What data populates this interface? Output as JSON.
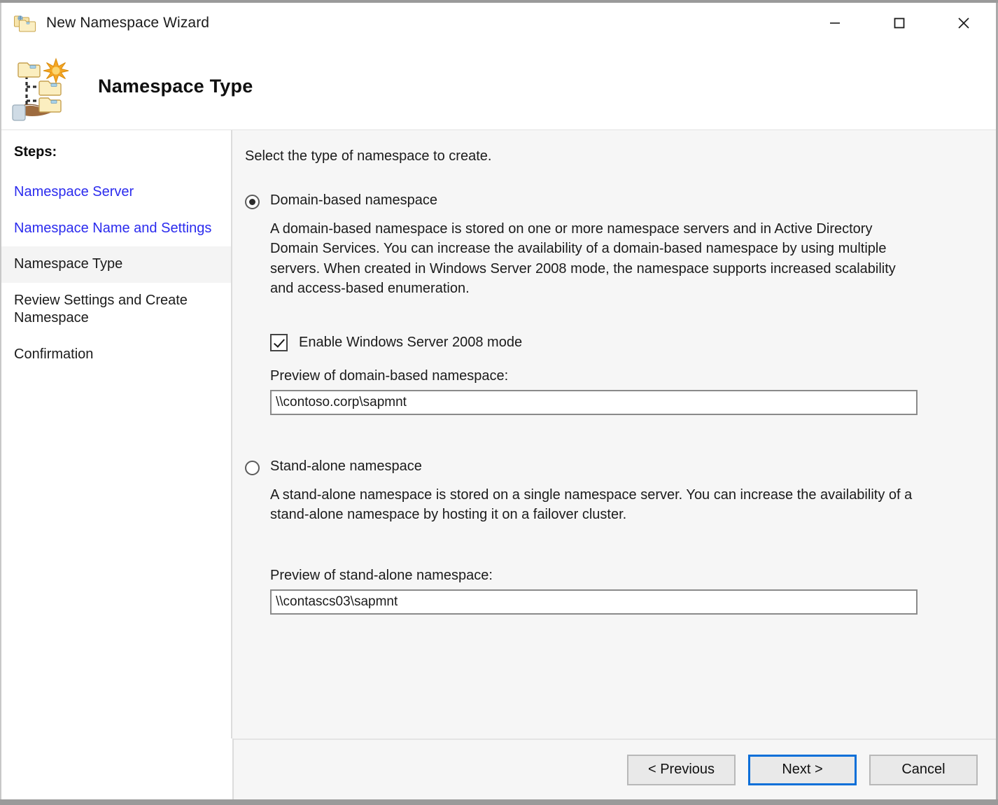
{
  "window": {
    "title": "New Namespace Wizard",
    "icon": "namespace-folders-icon",
    "controls": {
      "minimize": "minimize-icon",
      "maximize": "maximize-icon",
      "close": "close-icon"
    }
  },
  "header": {
    "title": "Namespace Type",
    "icon": "dfs-namespace-icon"
  },
  "sidebar": {
    "heading": "Steps:",
    "items": [
      {
        "label": "Namespace Server",
        "state": "link"
      },
      {
        "label": "Namespace Name and Settings",
        "state": "link"
      },
      {
        "label": "Namespace Type",
        "state": "current"
      },
      {
        "label": "Review Settings and Create Namespace",
        "state": "pending"
      },
      {
        "label": "Confirmation",
        "state": "pending"
      }
    ]
  },
  "main": {
    "intro": "Select the type of namespace to create.",
    "options": [
      {
        "id": "domain-based",
        "label": "Domain-based namespace",
        "selected": true,
        "description": "A domain-based namespace is stored on one or more namespace servers and in Active Directory Domain Services. You can increase the availability of a domain-based namespace by using multiple servers. When created in Windows Server 2008 mode, the namespace supports increased scalability and access-based enumeration.",
        "checkbox": {
          "label": "Enable Windows Server 2008 mode",
          "checked": true
        },
        "preview_label": "Preview of domain-based namespace:",
        "preview_value": "\\\\contoso.corp\\sapmnt"
      },
      {
        "id": "stand-alone",
        "label": "Stand-alone namespace",
        "selected": false,
        "description": "A stand-alone namespace is stored on a single namespace server. You can increase the availability of a stand-alone namespace by hosting it on a failover cluster.",
        "preview_label": "Preview of stand-alone namespace:",
        "preview_value": "\\\\contascs03\\sapmnt"
      }
    ]
  },
  "footer": {
    "previous": "< Previous",
    "next": "Next >",
    "cancel": "Cancel"
  },
  "colors": {
    "link": "#2b2bee",
    "focus_border": "#0b6fd8",
    "content_bg": "#f6f6f6",
    "sidebar_bg": "#ffffff",
    "selected_step_bg": "#f4f4f4"
  }
}
